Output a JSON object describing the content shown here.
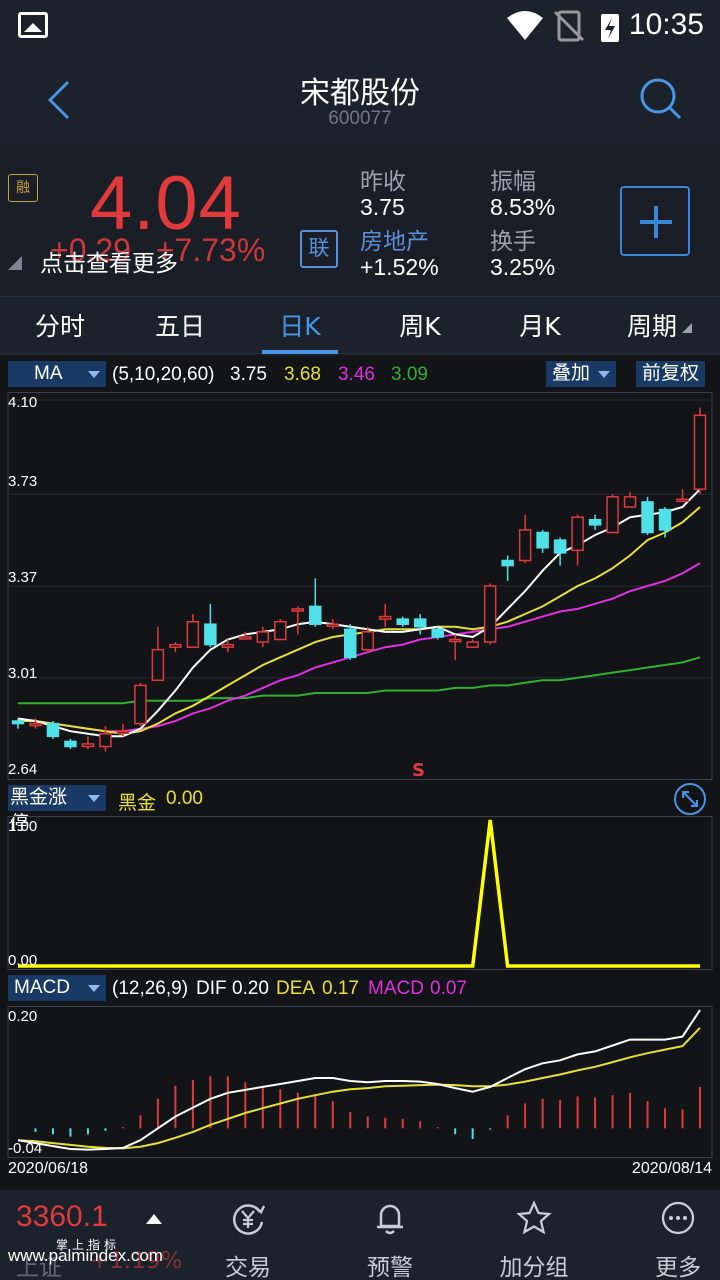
{
  "status": {
    "time": "10:35"
  },
  "header": {
    "name": "宋都股份",
    "code": "600077"
  },
  "quote": {
    "badge": "融",
    "price": "4.04",
    "change": "+0.29",
    "change_pct": "+7.73%",
    "hint": "点击查看更多",
    "link_label": "联",
    "prev_close_label": "昨收",
    "prev_close": "3.75",
    "sector_label": "房地产",
    "sector_change": "+1.52%",
    "amplitude_label": "振幅",
    "amplitude": "8.53%",
    "turnover_label": "换手",
    "turnover": "3.25%"
  },
  "tabs": [
    "分时",
    "五日",
    "日K",
    "周K",
    "月K",
    "周期"
  ],
  "ma_bar": {
    "name": "MA",
    "params": "(5,10,20,60)",
    "v5": "3.75",
    "v10": "3.68",
    "v20": "3.46",
    "v60": "3.09",
    "overlay": "叠加",
    "adjust": "前复权"
  },
  "main_axis": [
    "4.10",
    "3.73",
    "3.37",
    "3.01",
    "2.64"
  ],
  "marker": "S",
  "hj_bar": {
    "name": "黑金涨停",
    "label": "黑金",
    "value": "0.00"
  },
  "hj_axis": [
    "1.00",
    "0.00"
  ],
  "macd_bar": {
    "name": "MACD",
    "params": "(12,26,9)",
    "dif_label": "DIF",
    "dif": "0.20",
    "dea_label": "DEA",
    "dea": "0.17",
    "macd_label": "MACD",
    "macd": "0.07"
  },
  "macd_axis": [
    "0.20",
    "-0.04"
  ],
  "dates": {
    "start": "2020/06/18",
    "end": "2020/08/14"
  },
  "bottom": {
    "index_value": "3360.1",
    "index_name": "上证",
    "index_change": "+1.19%",
    "nav": [
      "交易",
      "预警",
      "加分组",
      "更多"
    ]
  },
  "watermark": {
    "site": "www.palmindex.com",
    "brand": "掌上指标"
  },
  "colors": {
    "up": "#e03a3a",
    "down": "#4fe0e8",
    "ma5": "#ffffff",
    "ma10": "#e8e030",
    "ma20": "#e030e0",
    "ma60": "#30b030",
    "accent": "#4a94e6"
  },
  "chart_data": [
    {
      "type": "candlestick",
      "title": "日K",
      "ylim": [
        2.64,
        4.1
      ],
      "candles": [
        [
          2.84,
          2.83,
          2.85,
          2.81
        ],
        [
          2.83,
          2.83,
          2.85,
          2.81
        ],
        [
          2.83,
          2.78,
          2.84,
          2.77
        ],
        [
          2.76,
          2.74,
          2.77,
          2.73
        ],
        [
          2.74,
          2.75,
          2.78,
          2.73
        ],
        [
          2.74,
          2.79,
          2.82,
          2.72
        ],
        [
          2.8,
          2.8,
          2.83,
          2.78
        ],
        [
          2.83,
          2.98,
          2.99,
          2.82
        ],
        [
          3.0,
          3.12,
          3.21,
          3.0
        ],
        [
          3.13,
          3.14,
          3.15,
          3.11
        ],
        [
          3.13,
          3.23,
          3.26,
          3.13
        ],
        [
          3.22,
          3.14,
          3.3,
          3.13
        ],
        [
          3.13,
          3.14,
          3.16,
          3.11
        ],
        [
          3.17,
          3.17,
          3.19,
          3.16
        ],
        [
          3.15,
          3.19,
          3.21,
          3.13
        ],
        [
          3.16,
          3.23,
          3.24,
          3.16
        ],
        [
          3.28,
          3.28,
          3.29,
          3.18
        ],
        [
          3.29,
          3.22,
          3.4,
          3.21
        ],
        [
          3.22,
          3.22,
          3.24,
          3.2
        ],
        [
          3.2,
          3.09,
          3.22,
          3.08
        ],
        [
          3.12,
          3.19,
          3.21,
          3.11
        ],
        [
          3.24,
          3.25,
          3.3,
          3.21
        ],
        [
          3.24,
          3.22,
          3.25,
          3.21
        ],
        [
          3.24,
          3.21,
          3.26,
          3.18
        ],
        [
          3.2,
          3.17,
          3.21,
          3.16
        ],
        [
          3.16,
          3.16,
          3.18,
          3.08
        ],
        [
          3.13,
          3.15,
          3.16,
          3.13
        ],
        [
          3.15,
          3.37,
          3.38,
          3.14
        ],
        [
          3.47,
          3.45,
          3.49,
          3.39
        ],
        [
          3.47,
          3.59,
          3.65,
          3.46
        ],
        [
          3.58,
          3.52,
          3.59,
          3.5
        ],
        [
          3.55,
          3.5,
          3.56,
          3.45
        ],
        [
          3.51,
          3.64,
          3.65,
          3.45
        ],
        [
          3.63,
          3.61,
          3.65,
          3.59
        ],
        [
          3.58,
          3.72,
          3.73,
          3.58
        ],
        [
          3.68,
          3.72,
          3.74,
          3.7
        ],
        [
          3.7,
          3.58,
          3.72,
          3.57
        ],
        [
          3.67,
          3.59,
          3.68,
          3.56
        ],
        [
          3.71,
          3.71,
          3.75,
          3.7
        ],
        [
          3.75,
          4.04,
          4.07,
          3.73
        ]
      ],
      "ma5": [
        2.85,
        2.84,
        2.82,
        2.8,
        2.79,
        2.78,
        2.78,
        2.81,
        2.88,
        2.96,
        3.05,
        3.12,
        3.16,
        3.18,
        3.19,
        3.2,
        3.22,
        3.23,
        3.22,
        3.21,
        3.2,
        3.19,
        3.19,
        3.2,
        3.21,
        3.18,
        3.17,
        3.21,
        3.28,
        3.35,
        3.43,
        3.5,
        3.53,
        3.57,
        3.6,
        3.64,
        3.65,
        3.66,
        3.68,
        3.75
      ],
      "ma10": [
        2.84,
        2.84,
        2.83,
        2.82,
        2.81,
        2.8,
        2.79,
        2.8,
        2.83,
        2.87,
        2.9,
        2.94,
        2.98,
        3.02,
        3.06,
        3.09,
        3.12,
        3.15,
        3.17,
        3.18,
        3.19,
        3.2,
        3.2,
        3.2,
        3.21,
        3.21,
        3.2,
        3.21,
        3.23,
        3.26,
        3.29,
        3.33,
        3.37,
        3.4,
        3.44,
        3.49,
        3.55,
        3.58,
        3.62,
        3.68
      ],
      "ma20": [
        2.85,
        2.84,
        2.83,
        2.82,
        2.81,
        2.8,
        2.8,
        2.81,
        2.82,
        2.84,
        2.87,
        2.89,
        2.92,
        2.94,
        2.97,
        3.0,
        3.02,
        3.05,
        3.07,
        3.09,
        3.11,
        3.13,
        3.14,
        3.16,
        3.17,
        3.18,
        3.19,
        3.2,
        3.21,
        3.23,
        3.25,
        3.27,
        3.28,
        3.3,
        3.32,
        3.35,
        3.37,
        3.39,
        3.42,
        3.46
      ],
      "ma60": [
        2.91,
        2.91,
        2.91,
        2.91,
        2.91,
        2.91,
        2.91,
        2.92,
        2.92,
        2.92,
        2.92,
        2.93,
        2.93,
        2.93,
        2.94,
        2.94,
        2.94,
        2.95,
        2.95,
        2.95,
        2.95,
        2.96,
        2.96,
        2.96,
        2.96,
        2.97,
        2.97,
        2.98,
        2.98,
        2.99,
        3.0,
        3.0,
        3.01,
        3.02,
        3.03,
        3.04,
        3.05,
        3.06,
        3.07,
        3.09
      ]
    },
    {
      "type": "line",
      "title": "黑金涨停",
      "ylim": [
        0,
        1
      ],
      "values": [
        0,
        0,
        0,
        0,
        0,
        0,
        0,
        0,
        0,
        0,
        0,
        0,
        0,
        0,
        0,
        0,
        0,
        0,
        0,
        0,
        0,
        0,
        0,
        0,
        0,
        0,
        0,
        1,
        0,
        0,
        0,
        0,
        0,
        0,
        0,
        0,
        0,
        0,
        0,
        0
      ]
    },
    {
      "type": "line",
      "title": "MACD",
      "ylim": [
        -0.04,
        0.2
      ],
      "dif": [
        -0.02,
        -0.025,
        -0.03,
        -0.035,
        -0.036,
        -0.035,
        -0.033,
        -0.02,
        0.0,
        0.02,
        0.035,
        0.05,
        0.06,
        0.065,
        0.07,
        0.075,
        0.08,
        0.085,
        0.085,
        0.08,
        0.078,
        0.08,
        0.08,
        0.079,
        0.075,
        0.068,
        0.062,
        0.07,
        0.085,
        0.1,
        0.11,
        0.115,
        0.125,
        0.13,
        0.14,
        0.15,
        0.15,
        0.15,
        0.155,
        0.2
      ],
      "dea": [
        -0.02,
        -0.022,
        -0.025,
        -0.028,
        -0.031,
        -0.033,
        -0.034,
        -0.031,
        -0.025,
        -0.016,
        -0.006,
        0.006,
        0.016,
        0.026,
        0.034,
        0.042,
        0.05,
        0.056,
        0.062,
        0.066,
        0.068,
        0.071,
        0.072,
        0.073,
        0.074,
        0.073,
        0.071,
        0.071,
        0.074,
        0.079,
        0.085,
        0.091,
        0.098,
        0.104,
        0.112,
        0.12,
        0.127,
        0.133,
        0.139,
        0.17
      ],
      "macd": [
        0.0,
        -0.006,
        -0.01,
        -0.014,
        -0.01,
        -0.004,
        0.002,
        0.022,
        0.05,
        0.072,
        0.082,
        0.088,
        0.088,
        0.078,
        0.072,
        0.066,
        0.06,
        0.058,
        0.046,
        0.028,
        0.02,
        0.018,
        0.016,
        0.012,
        0.002,
        -0.01,
        -0.018,
        -0.002,
        0.022,
        0.042,
        0.05,
        0.048,
        0.054,
        0.052,
        0.056,
        0.06,
        0.046,
        0.034,
        0.032,
        0.07
      ]
    }
  ]
}
